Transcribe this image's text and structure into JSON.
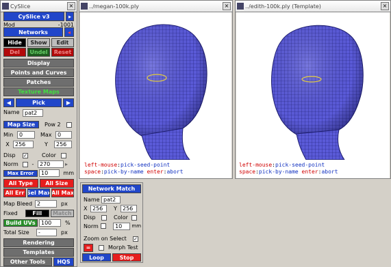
{
  "panel": {
    "title": "CySlice",
    "version_label": "CySlice v3",
    "vals": {
      "left": "Mod",
      "right": "-1001"
    },
    "networks_label": "Networks",
    "hide": "Hide",
    "show": "Show",
    "edit": "Edit",
    "del": "Del",
    "undel": "Undel",
    "reset": "Reset",
    "display": "Display",
    "points_curves": "Points and Curves",
    "patches": "Patches",
    "texture_maps": "Texture Maps",
    "pick": "Pick",
    "name_label": "Name",
    "name_value": "pat2",
    "map_size": "Map Size",
    "pow2": "Pow 2",
    "min_label": "Min",
    "min_value": "0",
    "max_label": "Max",
    "max_value": "0",
    "x_label": "X",
    "x_value": "256",
    "y_label": "Y",
    "y_value": "256",
    "disp": "Disp",
    "color": "Color",
    "norm": "Norm",
    "norm_value": "270",
    "max_error": "Max Error",
    "max_error_value": "10",
    "mm": "mm",
    "all_type": "All Type",
    "all_size": "All Size",
    "all_err": "All Err",
    "sel_max": "Sel Max",
    "all_max": "All Max",
    "map_bleed": "Map Bleed",
    "map_bleed_value": "2",
    "px": "px",
    "fixed": "Fixed",
    "fill": "Fill",
    "match": "Match",
    "build_uvs": "Build UVs",
    "build_value": "100",
    "pct": "%",
    "total_size": "Total Size",
    "total_value": "-",
    "px2": "px",
    "rendering": "Rendering",
    "templates": "Templates",
    "other_tools": "Other Tools",
    "hqs": "HQS"
  },
  "win1": {
    "title": "../megan-100k.ply",
    "status1_key": "left-mouse",
    "status1_val": "pick-seed-point",
    "status2_key1": "space",
    "status2_val1": "pick-by-name",
    "status2_key2": "enter",
    "status2_val2": "abort"
  },
  "win2": {
    "title": "../edith-100k.ply (Template)",
    "status1_key": "left-mouse",
    "status1_val": "pick-seed-point",
    "status2_key1": "space",
    "status2_val1": "pick-by-name",
    "status2_key2": "enter",
    "status2_val2": "abort"
  },
  "match": {
    "title": "Network Match",
    "name_label": "Name",
    "name_value": "pat2",
    "x_label": "X",
    "x_value": "256",
    "y_label": "Y",
    "y_value": "256",
    "disp": "Disp",
    "color": "Color",
    "norm": "Norm",
    "norm_value": "10",
    "mm": "mm",
    "zoom": "Zoom on Select",
    "morph": "Morph Test",
    "loop": "Loop",
    "stop": "Stop"
  },
  "colors": {
    "mesh": "#5a5ad8",
    "mesh_dark": "#2a2a80",
    "button_blue": "#2146c9",
    "button_red": "#e61d1d"
  }
}
